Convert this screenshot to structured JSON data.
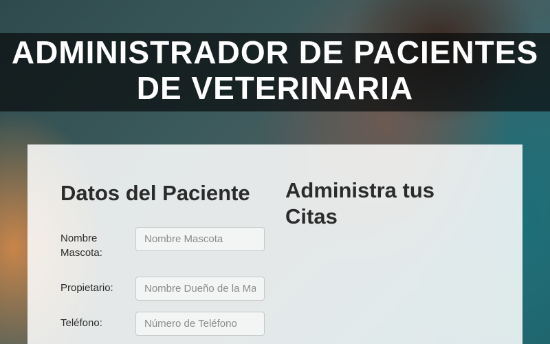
{
  "header": {
    "title_line1": "ADMINISTRADOR DE PACIENTES",
    "title_line2": "DE VETERINARIA"
  },
  "form": {
    "title": "Datos del Paciente",
    "fields": [
      {
        "label": "Nombre Mascota:",
        "placeholder": "Nombre Mascota",
        "value": ""
      },
      {
        "label": "Propietario:",
        "placeholder": "Nombre Dueño de la Mascota",
        "value": ""
      },
      {
        "label": "Teléfono:",
        "placeholder": "Número de Teléfono",
        "value": ""
      }
    ]
  },
  "appointments": {
    "title_line1": "Administra tus",
    "title_line2": "Citas"
  }
}
